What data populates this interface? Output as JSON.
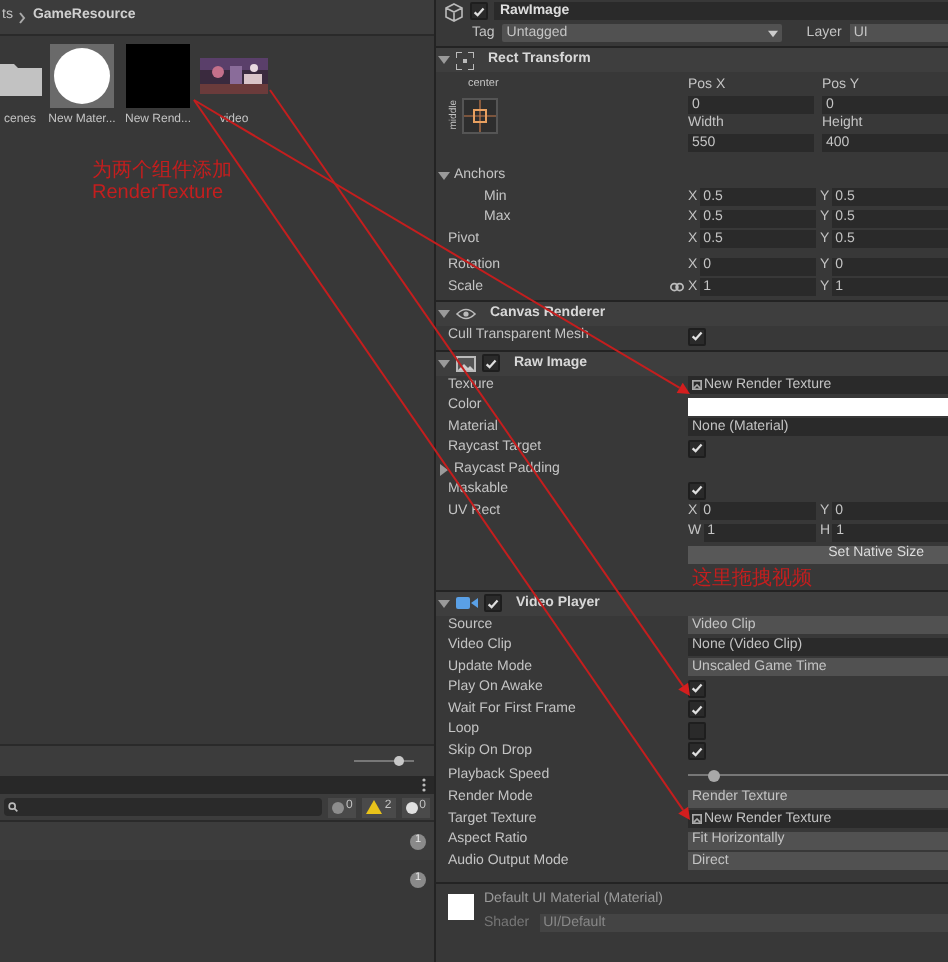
{
  "project": {
    "breadcrumb": [
      "ts",
      "GameResource"
    ],
    "assets": [
      {
        "kind": "folder",
        "label": "cenes"
      },
      {
        "kind": "material",
        "label": "New Mater..."
      },
      {
        "kind": "render_texture",
        "label": "New Rend..."
      },
      {
        "kind": "video",
        "label": "video"
      }
    ],
    "zoom_slider": {
      "level": 0.75
    }
  },
  "annotations": [
    {
      "lines": [
        "为两个组件添加",
        "RenderTexture"
      ]
    },
    {
      "lines": [
        "这里拖拽视频"
      ]
    }
  ],
  "console": {
    "counts": [
      {
        "kind": "info",
        "count": "0"
      },
      {
        "kind": "warning",
        "count": "2"
      },
      {
        "kind": "error",
        "count": "0"
      }
    ],
    "rows": [
      {
        "count": "1"
      },
      {
        "count": "1"
      }
    ]
  },
  "inspector": {
    "name": "RawImage",
    "active": true,
    "tag_label": "Tag",
    "tag": "Untagged",
    "layer_label": "Layer",
    "layer": "UI",
    "components": [
      {
        "kind": "rect_transform",
        "title": "Rect Transform",
        "anchor_h": "center",
        "anchor_v": "middle",
        "fields": [
          {
            "label": "Pos X",
            "value": "0"
          },
          {
            "label": "Pos Y",
            "value": "0"
          },
          {
            "label": "Width",
            "value": "550"
          },
          {
            "label": "Height",
            "value": "400"
          }
        ],
        "rows": [
          {
            "kind": "foldout",
            "label": "Anchors",
            "expanded": true,
            "children": [
              {
                "kind": "vector",
                "label": "Min",
                "values": [
                  {
                    "axis": "X",
                    "value": "0.5"
                  },
                  {
                    "axis": "Y",
                    "value": "0.5"
                  }
                ]
              },
              {
                "kind": "vector",
                "label": "Max",
                "values": [
                  {
                    "axis": "X",
                    "value": "0.5"
                  },
                  {
                    "axis": "Y",
                    "value": "0.5"
                  }
                ]
              }
            ]
          },
          {
            "kind": "vector",
            "label": "Pivot",
            "values": [
              {
                "axis": "X",
                "value": "0.5"
              },
              {
                "axis": "Y",
                "value": "0.5"
              }
            ]
          },
          {
            "kind": "vector",
            "label": "Rotation",
            "values": [
              {
                "axis": "X",
                "value": "0"
              },
              {
                "axis": "Y",
                "value": "0"
              }
            ]
          },
          {
            "kind": "vector",
            "label": "Scale",
            "linked": true,
            "values": [
              {
                "axis": "X",
                "value": "1"
              },
              {
                "axis": "Y",
                "value": "1"
              }
            ]
          }
        ]
      },
      {
        "kind": "canvas_renderer",
        "title": "Canvas Renderer",
        "rows": [
          {
            "kind": "checkbox",
            "label": "Cull Transparent Mesh",
            "checked": true
          }
        ]
      },
      {
        "kind": "raw_image",
        "title": "Raw Image",
        "enabled": true,
        "rows": [
          {
            "kind": "object",
            "label": "Texture",
            "value": "New Render Texture",
            "asset": true
          },
          {
            "kind": "color",
            "label": "Color",
            "color": "#ffffff"
          },
          {
            "kind": "object",
            "label": "Material",
            "value": "None (Material)"
          },
          {
            "kind": "checkbox",
            "label": "Raycast Target",
            "checked": true
          },
          {
            "kind": "foldout",
            "label": "Raycast Padding",
            "expanded": false
          },
          {
            "kind": "checkbox",
            "label": "Maskable",
            "checked": true
          },
          {
            "kind": "vector",
            "label": "UV Rect",
            "values": [
              {
                "axis": "X",
                "value": "0"
              },
              {
                "axis": "Y",
                "value": "0"
              },
              {
                "axis": "W",
                "value": "1"
              },
              {
                "axis": "H",
                "value": "1"
              }
            ]
          },
          {
            "kind": "button",
            "label": "Set Native Size"
          }
        ]
      },
      {
        "kind": "video_player",
        "title": "Video Player",
        "enabled": true,
        "rows": [
          {
            "kind": "dropdown",
            "label": "Source",
            "value": "Video Clip"
          },
          {
            "kind": "object",
            "label": "Video Clip",
            "value": "None (Video Clip)"
          },
          {
            "kind": "dropdown",
            "label": "Update Mode",
            "value": "Unscaled Game Time"
          },
          {
            "kind": "checkbox",
            "label": "Play On Awake",
            "checked": true
          },
          {
            "kind": "checkbox",
            "label": "Wait For First Frame",
            "checked": true
          },
          {
            "kind": "checkbox",
            "label": "Loop",
            "checked": false
          },
          {
            "kind": "checkbox",
            "label": "Skip On Drop",
            "checked": true
          },
          {
            "kind": "slider",
            "label": "Playback Speed",
            "level": 0.1
          },
          {
            "kind": "dropdown",
            "label": "Render Mode",
            "value": "Render Texture"
          },
          {
            "kind": "object",
            "label": "Target Texture",
            "value": "New Render Texture",
            "asset": true
          },
          {
            "kind": "dropdown",
            "label": "Aspect Ratio",
            "value": "Fit Horizontally"
          },
          {
            "kind": "dropdown",
            "label": "Audio Output Mode",
            "value": "Direct"
          }
        ]
      },
      {
        "kind": "material",
        "title": "Default UI Material (Material)",
        "shader_label": "Shader",
        "shader": "UI/Default"
      }
    ]
  }
}
